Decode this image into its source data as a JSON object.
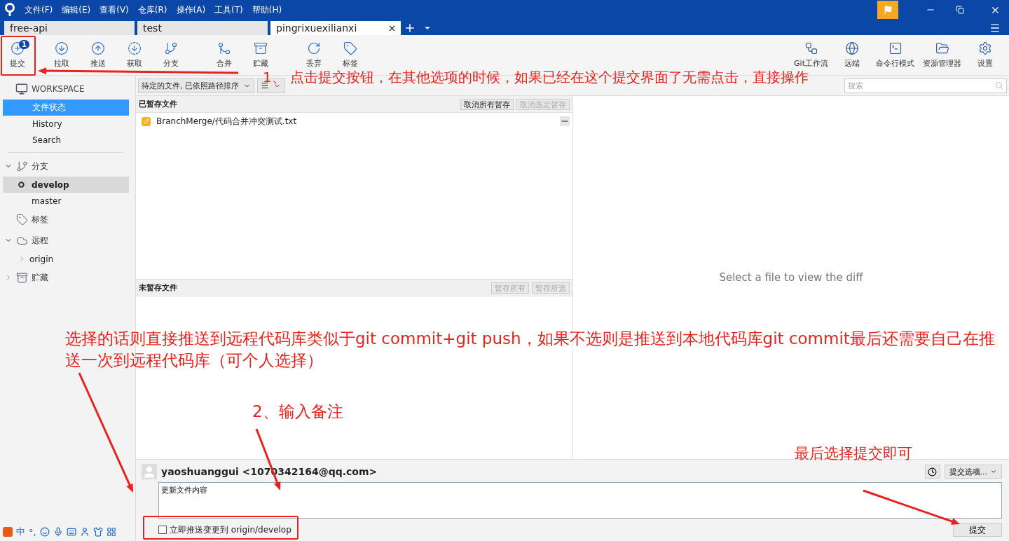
{
  "window": {
    "menu": [
      "文件(F)",
      "编辑(E)",
      "查看(V)",
      "仓库(R)",
      "操作(A)",
      "工具(T)",
      "帮助(H)"
    ]
  },
  "repo_tabs": [
    {
      "label": "free-api",
      "selected": false
    },
    {
      "label": "test",
      "selected": false
    },
    {
      "label": "pingrixuexilianxi",
      "selected": true
    }
  ],
  "toolbar": {
    "left": [
      {
        "label": "提交",
        "kind": "commit",
        "badge": "1"
      },
      {
        "label": "拉取",
        "kind": "pull"
      },
      {
        "label": "推送",
        "kind": "push"
      },
      {
        "label": "获取",
        "kind": "fetch"
      },
      {
        "label": "分支",
        "kind": "branch"
      },
      {
        "label": "合并",
        "kind": "merge"
      },
      {
        "label": "贮藏",
        "kind": "stash"
      },
      {
        "label": "丢弃",
        "kind": "discard"
      },
      {
        "label": "标签",
        "kind": "tag"
      }
    ],
    "right": [
      {
        "label": "Git工作流",
        "kind": "flow"
      },
      {
        "label": "远端",
        "kind": "remote"
      },
      {
        "label": "命令行模式",
        "kind": "terminal"
      },
      {
        "label": "资源管理器",
        "kind": "explorer"
      },
      {
        "label": "设置",
        "kind": "settings"
      }
    ]
  },
  "search": {
    "placeholder": "搜索"
  },
  "sidebar": {
    "workspace": {
      "title": "WORKSPACE",
      "items": [
        {
          "label": "文件状态",
          "selected": true
        },
        {
          "label": "History",
          "selected": false
        },
        {
          "label": "Search",
          "selected": false
        }
      ]
    },
    "sections": [
      {
        "label": "分支",
        "kind": "branch",
        "expanded": true,
        "children": [
          {
            "label": "develop",
            "current": true
          },
          {
            "label": "master",
            "current": false
          }
        ]
      },
      {
        "label": "标签",
        "kind": "tag"
      },
      {
        "label": "远程",
        "kind": "remote",
        "expanded": true,
        "children": [
          {
            "label": "origin",
            "expanded": false
          }
        ]
      },
      {
        "label": "贮藏",
        "kind": "stash",
        "expanded": false
      }
    ]
  },
  "filter": {
    "sort": "待定的文件, 已依照路径排序"
  },
  "staged": {
    "title": "已暂存文件",
    "buttons": [
      {
        "label": "取消所有暂存",
        "disabled": false
      },
      {
        "label": "取消选定暂存",
        "disabled": true
      }
    ],
    "files": [
      {
        "path": "BranchMerge/代码合并冲突测试.txt",
        "kind": "modified"
      }
    ]
  },
  "unstaged": {
    "title": "未暂存文件",
    "buttons": [
      {
        "label": "暂存所有",
        "disabled": true
      },
      {
        "label": "暂存所选",
        "disabled": true
      }
    ]
  },
  "diff": {
    "message": "Select a file to view the diff"
  },
  "commit": {
    "author": "yaoshuanggui <1070342164@qq.com>",
    "message": "更新文件内容",
    "push_option": {
      "label": "立即推送变更到 origin/develop",
      "checked": false
    },
    "options_button": "提交选项...",
    "submit_button": "提交"
  },
  "ime_bar": {
    "items": [
      "中",
      "°,"
    ]
  },
  "annotations": [
    {
      "kind": "note",
      "text": "1、 点击提交按钮，在其他选项的时候，如果已经在这个提交界面了无需点击，直接操作"
    },
    {
      "kind": "note",
      "text": "选择的话则直接推送到远程代码库类似于git commit+git push，如果不选则是推送到本地代码库git commit最后还需要自己在推送一次到远程代码库（可个人选择）"
    },
    {
      "kind": "note",
      "text": "2、输入备注"
    },
    {
      "kind": "note",
      "text": "最后选择提交即可"
    }
  ]
}
